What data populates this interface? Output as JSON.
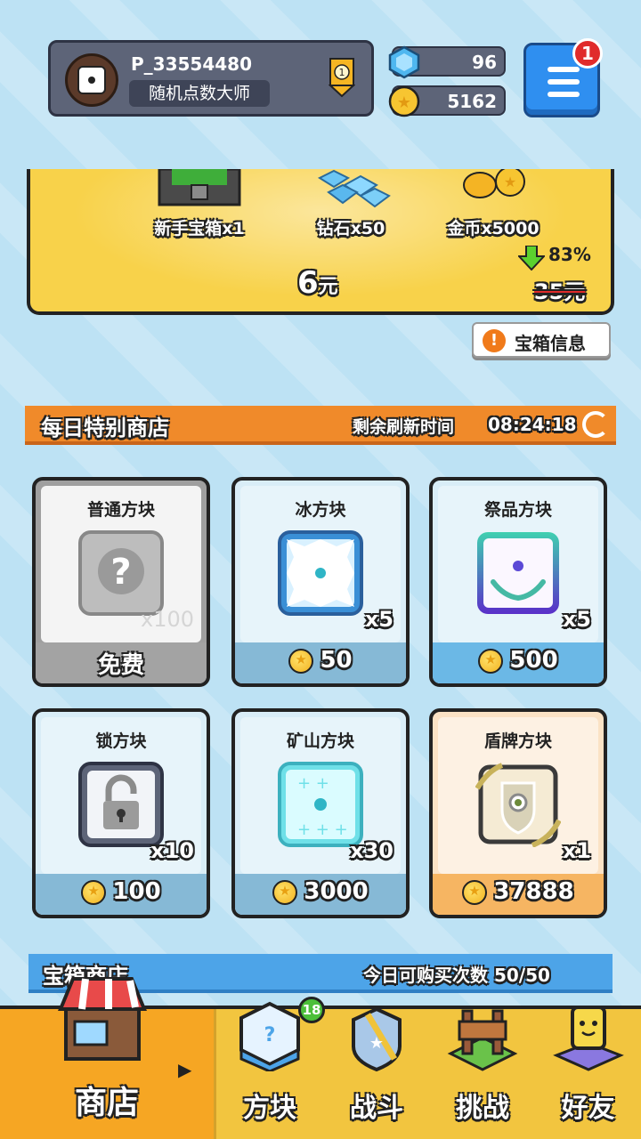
{
  "player": {
    "id": "P_33554480",
    "title": "随机点数大师",
    "rank_level": "1"
  },
  "currencies": {
    "diamonds": "96",
    "coins": "5162"
  },
  "menu": {
    "notification_count": "1"
  },
  "starter_pack": {
    "items": [
      {
        "label": "新手宝箱x1",
        "icon": "chest-icon"
      },
      {
        "label": "钻石x50",
        "icon": "diamond-pile-icon"
      },
      {
        "label": "金币x5000",
        "icon": "coin-pile-icon"
      }
    ],
    "price_value": "6",
    "price_unit": "元",
    "discount_percent": "83%",
    "original_price": "35元",
    "info_button_label": "宝箱信息"
  },
  "daily_shop": {
    "title": "每日特别商店",
    "refresh_label": "剩余刷新时间",
    "refresh_timer": "08:24:18",
    "cards": [
      {
        "name": "普通方块",
        "qty": "x100",
        "price": "免费",
        "has_coin": false,
        "icon": "question-dice-icon",
        "theme": "gray"
      },
      {
        "name": "冰方块",
        "qty": "x5",
        "price": "50",
        "has_coin": true,
        "icon": "ice-dice-icon",
        "theme": "blue"
      },
      {
        "name": "祭品方块",
        "qty": "x5",
        "price": "500",
        "has_coin": true,
        "icon": "sacrifice-dice-icon",
        "theme": "sky"
      },
      {
        "name": "锁方块",
        "qty": "x10",
        "price": "100",
        "has_coin": true,
        "icon": "lock-dice-icon",
        "theme": "blue"
      },
      {
        "name": "矿山方块",
        "qty": "x30",
        "price": "3000",
        "has_coin": true,
        "icon": "mine-dice-icon",
        "theme": "blue"
      },
      {
        "name": "盾牌方块",
        "qty": "x1",
        "price": "37888",
        "has_coin": true,
        "icon": "shield-dice-icon",
        "theme": "orange"
      }
    ]
  },
  "chest_shop": {
    "title": "宝箱商店",
    "limit_label": "今日可购买次数",
    "limit_value": "50/50"
  },
  "bottom_nav": {
    "items": [
      {
        "label": "商店",
        "icon": "shop-icon",
        "active": true
      },
      {
        "label": "方块",
        "icon": "dice-icon",
        "badge": "18"
      },
      {
        "label": "战斗",
        "icon": "battle-icon"
      },
      {
        "label": "挑战",
        "icon": "challenge-icon"
      },
      {
        "label": "好友",
        "icon": "friends-icon"
      }
    ]
  },
  "colors": {
    "accent_orange": "#f08a2a",
    "accent_blue": "#4da4e8",
    "nav_yellow": "#f2c53f",
    "pack_yellow": "#f8d24a"
  }
}
